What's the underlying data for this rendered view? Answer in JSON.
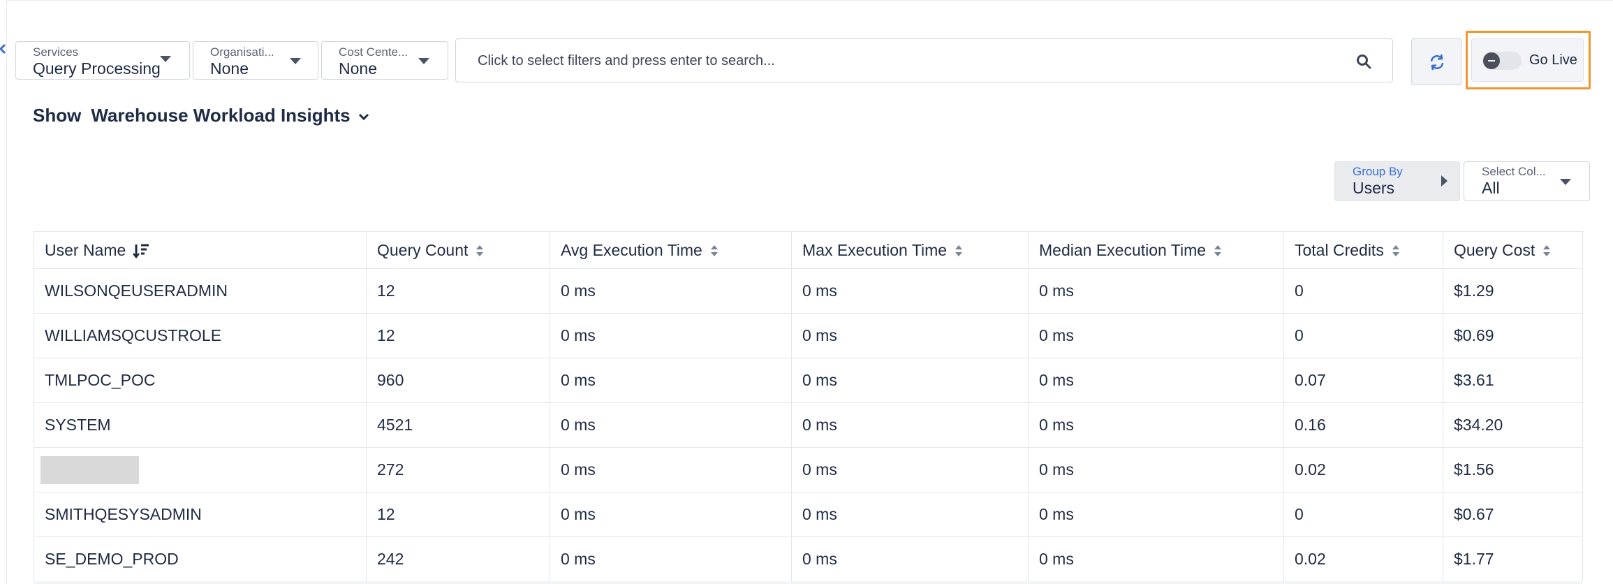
{
  "filters": {
    "services": {
      "label": "Services",
      "value": "Query Processing"
    },
    "organisation": {
      "label": "Organisati...",
      "value": "None"
    },
    "cost_center": {
      "label": "Cost Cente...",
      "value": "None"
    }
  },
  "search": {
    "placeholder": "Click to select filters and press enter to search..."
  },
  "icons": {
    "search": "search-icon",
    "refresh": "refresh-icon",
    "toggle": "toggle-switch",
    "chevron": "chevron-down-icon",
    "sort": "sort-icon",
    "collapse": "chevron-left-icon"
  },
  "colors": {
    "highlight": "#f0962f",
    "accent": "#3b6fd0",
    "text": "#1f2a44"
  },
  "golive": {
    "label": "Go Live",
    "enabled": false
  },
  "insights": {
    "show_label": "Show",
    "selected": "Warehouse Workload Insights"
  },
  "groupby": {
    "label": "Group By",
    "value": "Users"
  },
  "select_columns": {
    "label": "Select Col...",
    "value": "All"
  },
  "table": {
    "headers": [
      "User Name",
      "Query Count",
      "Avg Execution Time",
      "Max Execution Time",
      "Median Execution Time",
      "Total Credits",
      "Query Cost"
    ],
    "rows": [
      [
        "WILSONQEUSERADMIN",
        "12",
        "0 ms",
        "0 ms",
        "0 ms",
        "0",
        "$1.29"
      ],
      [
        "WILLIAMSQCUSTROLE",
        "12",
        "0 ms",
        "0 ms",
        "0 ms",
        "0",
        "$0.69"
      ],
      [
        "TMLPOC_POC",
        "960",
        "0 ms",
        "0 ms",
        "0 ms",
        "0.07",
        "$3.61"
      ],
      [
        "SYSTEM",
        "4521",
        "0 ms",
        "0 ms",
        "0 ms",
        "0.16",
        "$34.20"
      ],
      [
        "",
        "272",
        "0 ms",
        "0 ms",
        "0 ms",
        "0.02",
        "$1.56"
      ],
      [
        "SMITHQESYSADMIN",
        "12",
        "0 ms",
        "0 ms",
        "0 ms",
        "0",
        "$0.67"
      ],
      [
        "SE_DEMO_PROD",
        "242",
        "0 ms",
        "0 ms",
        "0 ms",
        "0.02",
        "$1.77"
      ]
    ]
  }
}
